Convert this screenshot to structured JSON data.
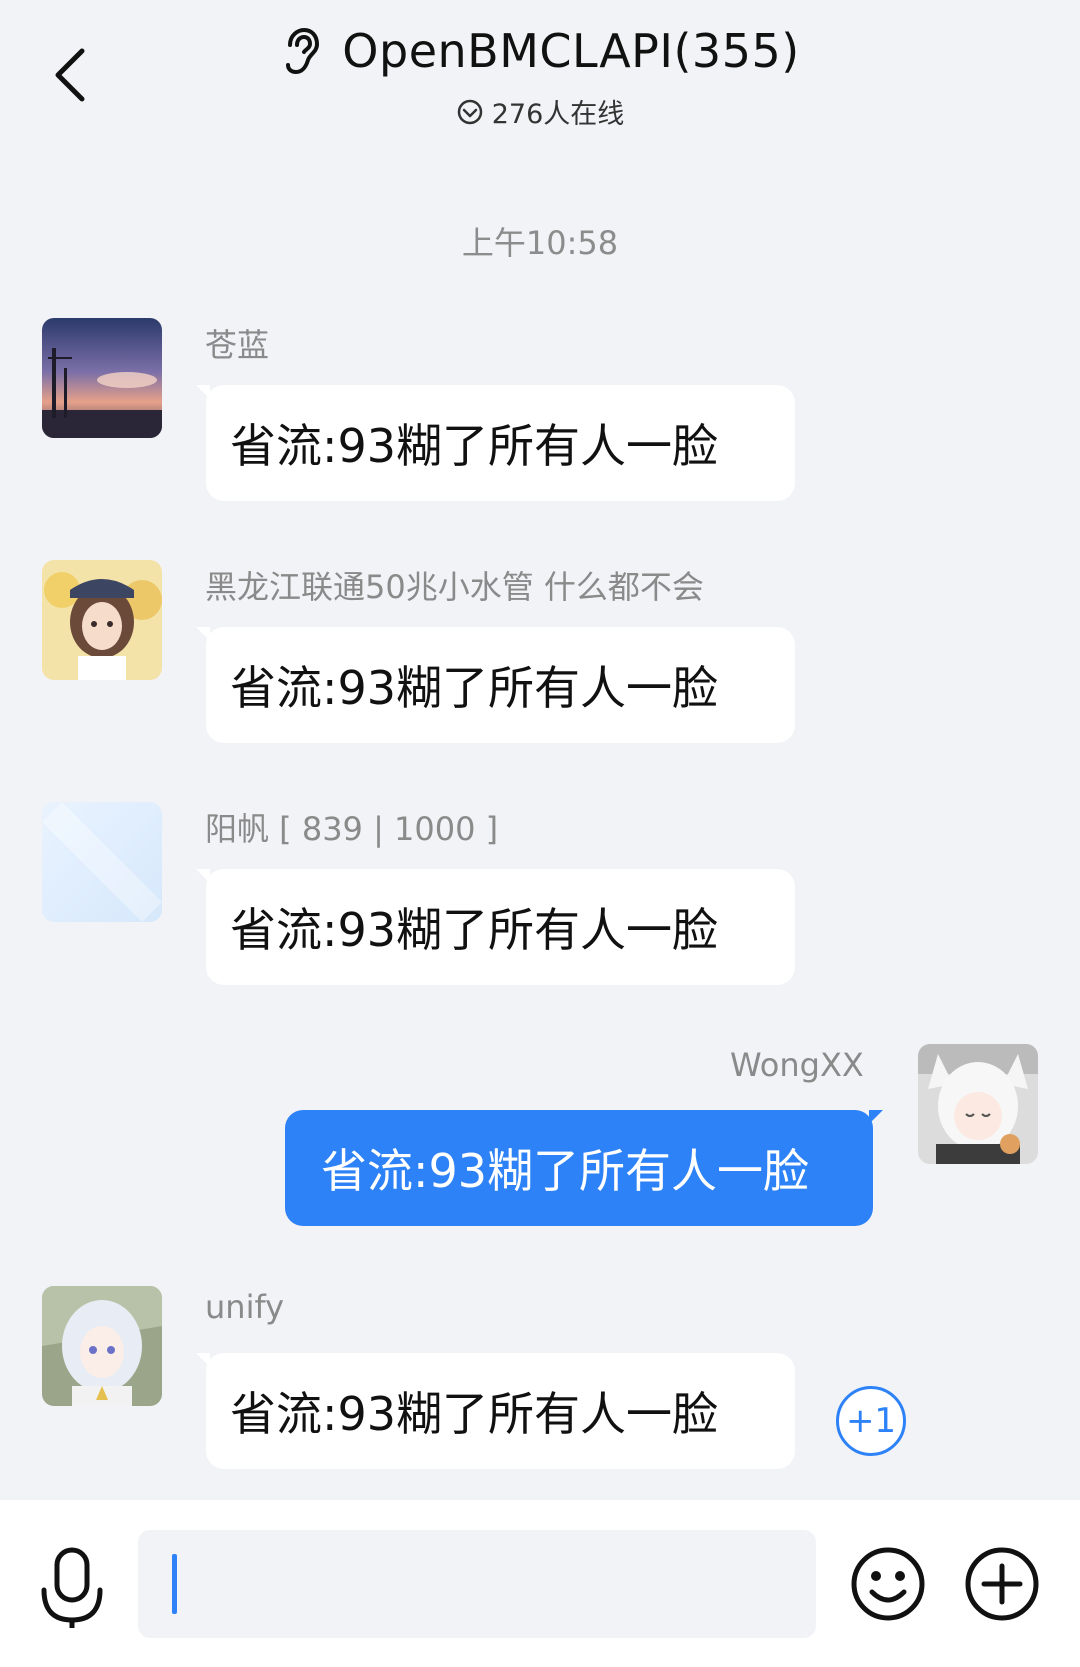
{
  "header": {
    "title": "OpenBMCLAPI(355)",
    "online": "276人在线",
    "icons": [
      "back-arrow-icon",
      "ear-icon",
      "check-circle-icon"
    ]
  },
  "timestamp": "上午10:58",
  "messages": [
    {
      "sender": "苍蓝",
      "text": "省流:93糊了所有人一脸",
      "direction": "in"
    },
    {
      "sender": "黑龙江联通50兆小水管 什么都不会",
      "text": "省流:93糊了所有人一脸",
      "direction": "in"
    },
    {
      "sender": "阳帆 [ 839 | 1000 ]",
      "text": "省流:93糊了所有人一脸",
      "direction": "in"
    },
    {
      "sender": "WongXX",
      "text": "省流:93糊了所有人一脸",
      "direction": "out"
    },
    {
      "sender": "unify",
      "text": "省流:93糊了所有人一脸",
      "direction": "in"
    }
  ],
  "plus_one": "+1",
  "composer": {
    "value": "",
    "icons": [
      "microphone-icon",
      "emoji-icon",
      "plus-circle-icon"
    ]
  },
  "colors": {
    "accent": "#2e82f7",
    "background": "#f2f3f7",
    "bubble_in": "#ffffff"
  }
}
